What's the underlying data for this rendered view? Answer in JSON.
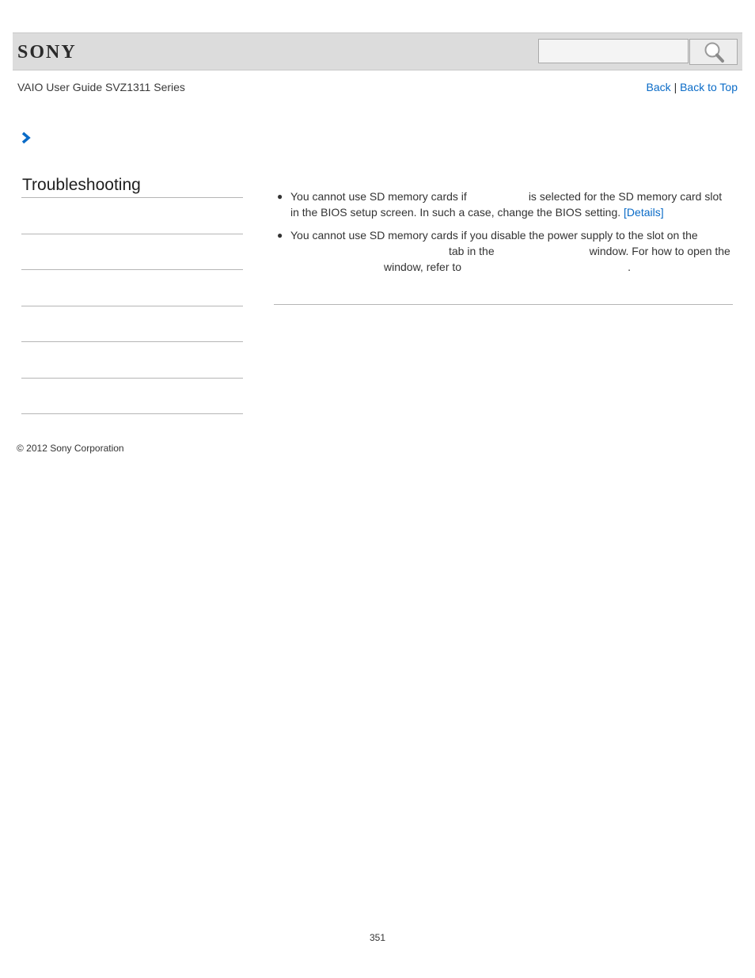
{
  "header": {
    "logo_text": "SONY",
    "search_placeholder": "",
    "accent_color": "#0a6bc7"
  },
  "nav": {
    "guide_title": "VAIO User Guide SVZ1311 Series",
    "back_label": "Back",
    "separator": "|",
    "back_to_top_label": "Back to Top"
  },
  "sidebar": {
    "section_title": "Troubleshooting",
    "item_count_visible_labels": ""
  },
  "content": {
    "bullet1": {
      "part1": "You cannot use SD memory cards if",
      "part2": "is selected for the SD memory card slot in the BIOS setup screen. In such a case, change the BIOS setting.",
      "link": "[Details]"
    },
    "bullet2": {
      "part1": "You cannot use SD memory cards if you disable the power supply to the slot on the",
      "part2": "tab in the",
      "part3": "window. For how to open the",
      "part4": "window, refer to",
      "part5": "."
    }
  },
  "footer": {
    "copyright": "© 2012 Sony Corporation",
    "page_number": "351"
  }
}
